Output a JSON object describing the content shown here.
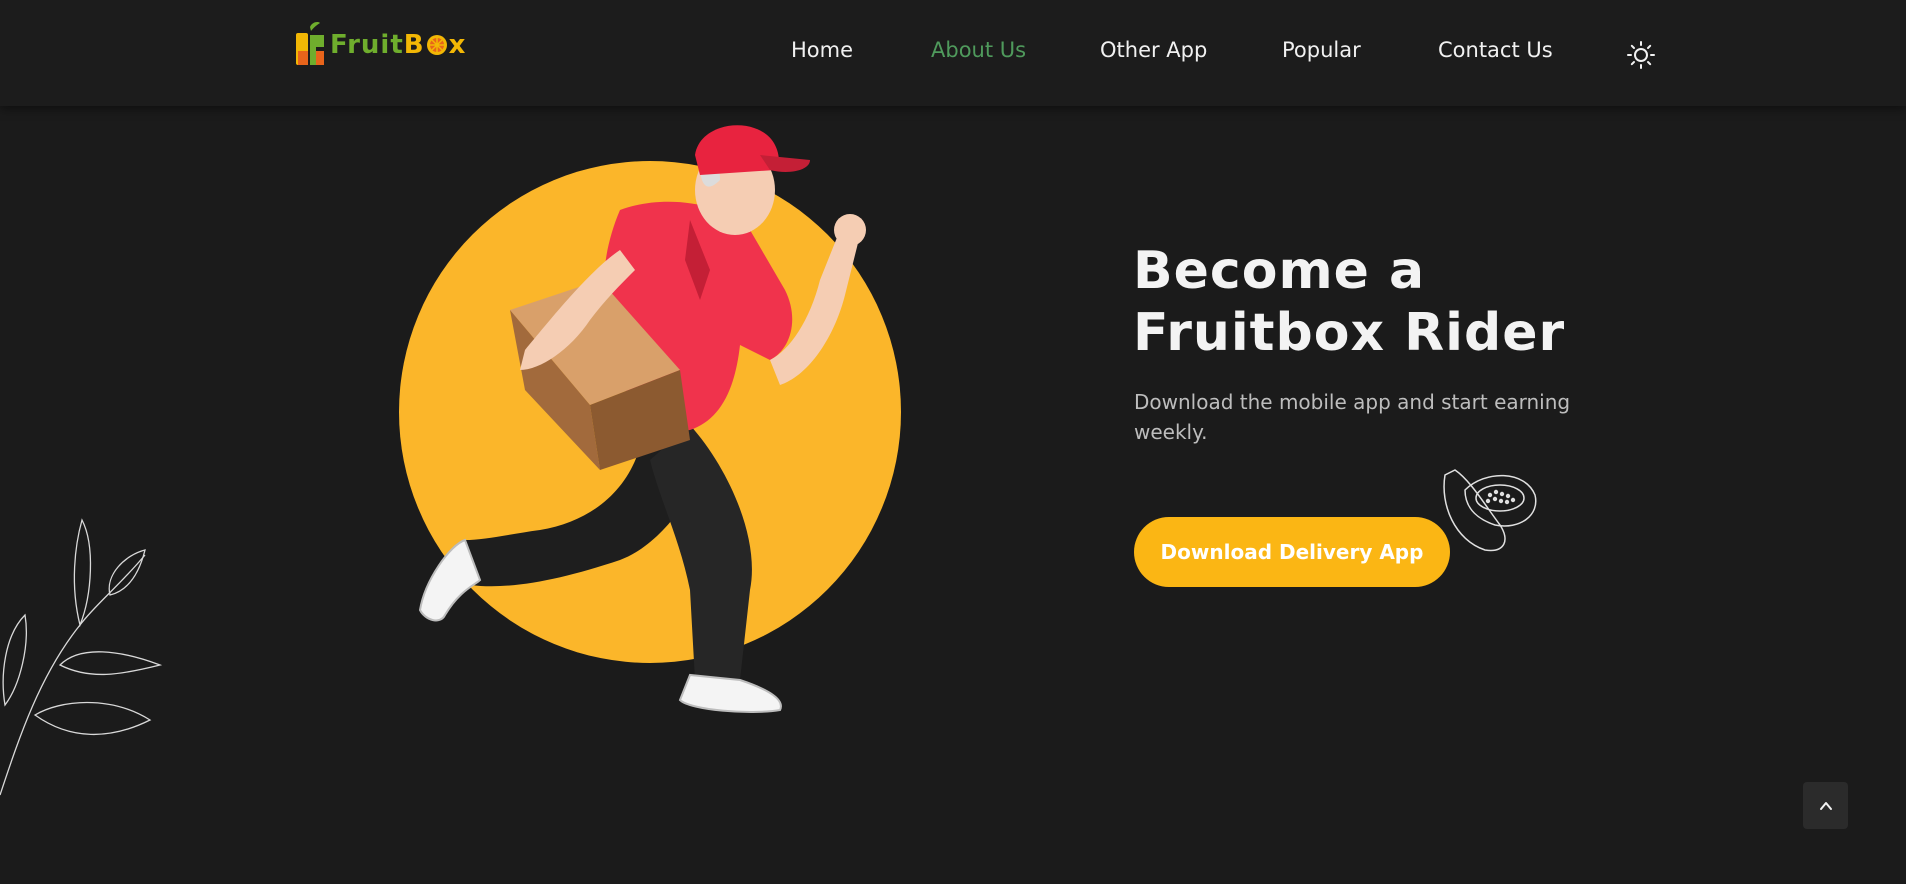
{
  "logo": {
    "word_fruit": "Fruit",
    "word_box_b": "B",
    "word_box_x": "x",
    "icon": "fruitbox-logo-icon",
    "colors": {
      "green": "#6fae2d",
      "yellow": "#f2b705",
      "orange": "#e8641b"
    }
  },
  "nav": {
    "items": [
      {
        "label": "Home",
        "active": false
      },
      {
        "label": "About Us",
        "active": true
      },
      {
        "label": "Other App",
        "active": false
      },
      {
        "label": "Popular",
        "active": false
      },
      {
        "label": "Contact Us",
        "active": false
      }
    ],
    "theme_toggle_icon": "sun-icon"
  },
  "hero": {
    "title_line1": "Become a",
    "title_line2": "Fruitbox Rider",
    "subtitle": "Download the mobile app and start earning weekly.",
    "cta_label": "Download Delivery App",
    "illustration": "delivery-rider-illustration",
    "decor": [
      "papaya-sketch-icon",
      "leaf-branch-sketch"
    ]
  },
  "scroll_top_icon": "chevron-up-icon",
  "colors": {
    "background": "#1b1b1b",
    "accent_yellow": "#fbb614",
    "nav_active": "#4f9a5c",
    "text": "#f2f2f2",
    "muted_text": "#bdbdbd"
  }
}
